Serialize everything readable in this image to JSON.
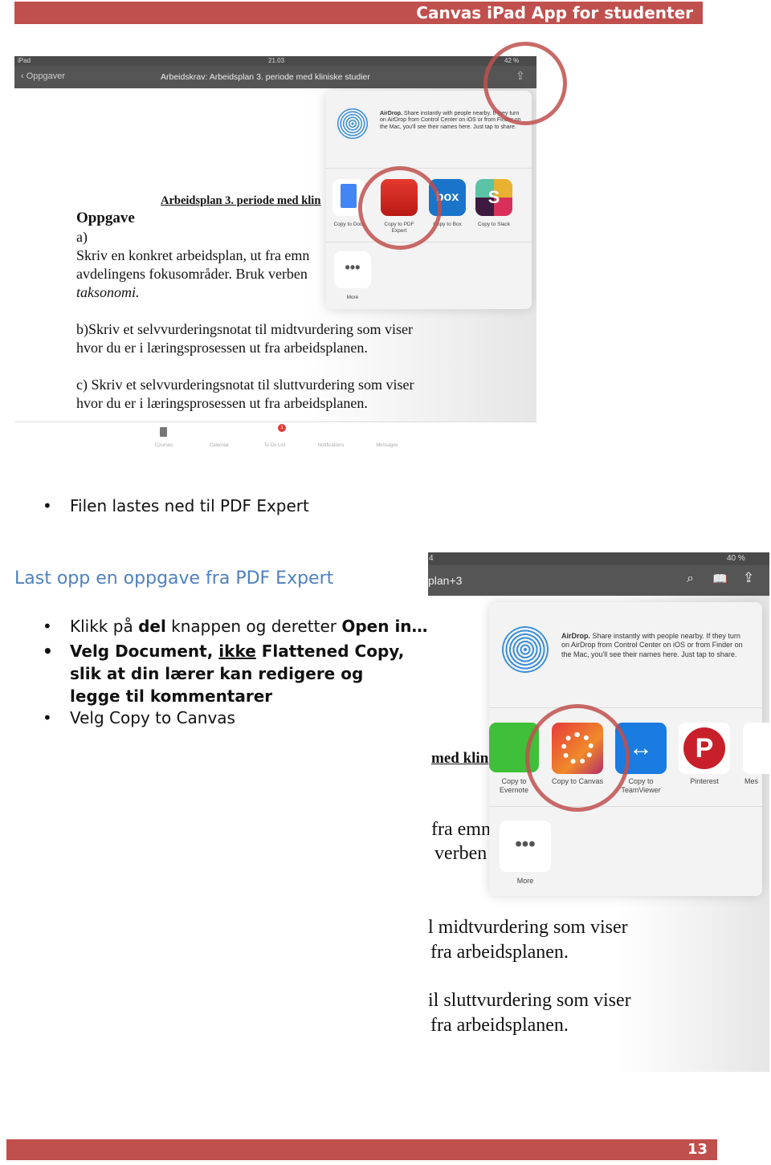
{
  "header": {
    "title": "Canvas iPad App for studenter"
  },
  "footer": {
    "page_number": "13"
  },
  "colors": {
    "accent": "#c0504d",
    "heading": "#4f81bd"
  },
  "screenshot1": {
    "status": {
      "device": "iPad",
      "time": "21.03",
      "battery": "42 %"
    },
    "nav": {
      "back": "Oppgaver",
      "title": "Arbeidskrav: Arbeidsplan 3. periode med kliniske studier"
    },
    "doc": {
      "title": "Arbeidsplan 3. periode med klin",
      "heading": "Oppgave",
      "a": "a)",
      "lines": [
        "Skriv en konkret arbeidsplan, ut fra emn",
        "avdelingens fokusområder. Bruk verben",
        "taksonomi."
      ],
      "b": [
        "b)Skriv et selvvurderingsnotat til midtvurdering som viser",
        "hvor du er i læringsprosessen ut fra arbeidsplanen."
      ],
      "c": [
        "c) Skriv et selvvurderingsnotat til sluttvurdering som viser",
        "hvor du er i læringsprosessen ut fra arbeidsplanen."
      ]
    },
    "share": {
      "airdrop_bold": "AirDrop.",
      "airdrop_text": " Share instantly with people nearby. If they turn on AirDrop from Control Center on iOS or from Finder on the Mac, you'll see their names here. Just tap to share.",
      "apps": [
        "Copy to Docs",
        "Copy to PDF Expert",
        "Copy to Box",
        "Copy to Slack"
      ],
      "more": "More"
    },
    "tabs": [
      "Courses",
      "Calendar",
      "To Do List",
      "Notifications",
      "Messages"
    ],
    "todo_badge": "1"
  },
  "bullet1": "Filen lastes ned til PDF Expert",
  "section": {
    "heading": "Last opp en oppgave fra PDF Expert",
    "b1": {
      "pre": "Klikk på ",
      "bold1": "del",
      "mid": " knappen og deretter ",
      "bold2": "Open in…"
    },
    "b2": {
      "bold1": "Velg Document, ",
      "under": "ikke",
      "bold2": " Flattened Copy, slik at din lærer kan redigere og legge til kommentarer"
    },
    "b3": "Velg Copy to Canvas"
  },
  "screenshot2": {
    "status": {
      "time": "4",
      "battery": "40 %"
    },
    "nav": {
      "title": "plan+3"
    },
    "share": {
      "airdrop_bold": "AirDrop.",
      "airdrop_text": " Share instantly with people nearby. If they turn on AirDrop from Control Center on iOS or from Finder on the Mac, you'll see their names here. Just tap to share.",
      "apps": [
        "Copy to Evernote",
        "Copy to Canvas",
        "Copy to TeamViewer",
        "Pinterest",
        "Mes"
      ],
      "more": "More"
    },
    "doc": [
      "med klin",
      "fra emn",
      "verben",
      "l midtvurdering som viser",
      "fra arbeidsplanen.",
      "il sluttvurdering som viser",
      "fra arbeidsplanen."
    ]
  }
}
